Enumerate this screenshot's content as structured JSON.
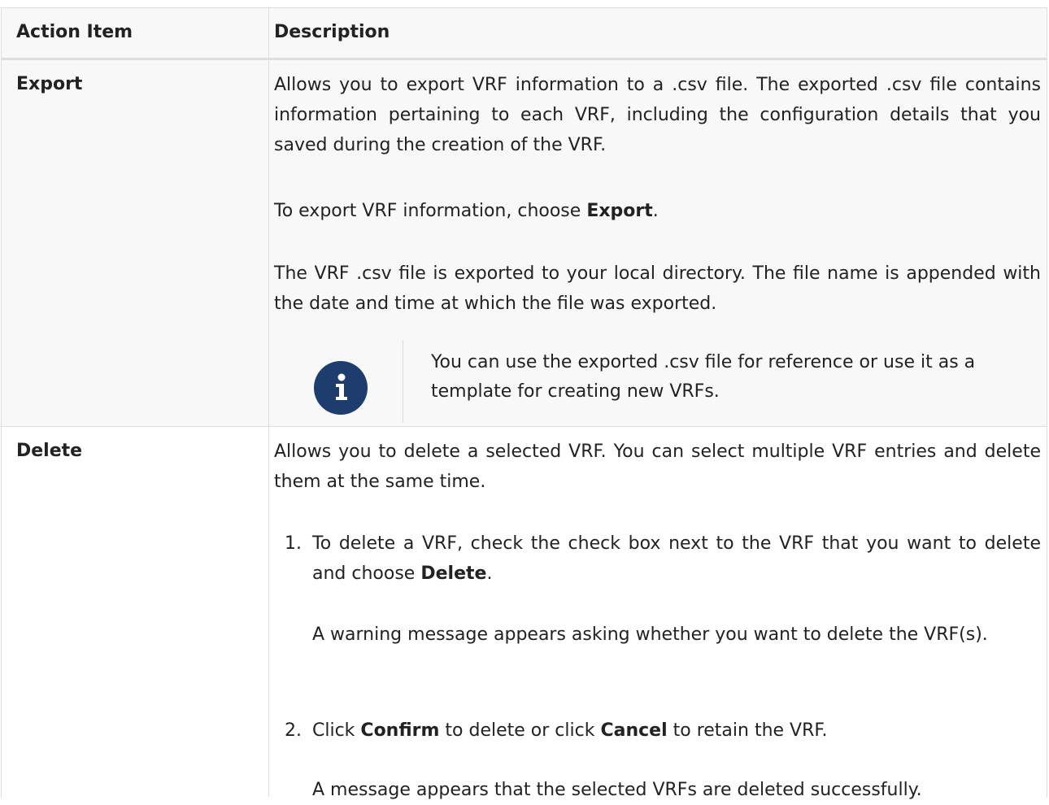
{
  "table": {
    "headers": [
      "Action Item",
      "Description"
    ],
    "rows": [
      {
        "action": "Export",
        "paragraphs": [
          "Allows you to export VRF information to a .csv file. The exported .csv file contains information pertaining to each VRF, including the configuration details that you saved during the creation of the VRF.",
          "To export VRF information, choose ",
          "The VRF .csv file is exported to your local directory. The file name is appended with the date and time at which the file was exported."
        ],
        "inline_bold": "Export",
        "inline_tail": ".",
        "note": {
          "icon": "info-icon",
          "text": "You can use the exported .csv file for reference or use it as a template for creating new VRFs."
        }
      },
      {
        "action": "Delete",
        "intro": "Allows you to delete a selected VRF. You can select multiple VRF entries and delete them at the same time.",
        "steps": [
          {
            "number": "1.",
            "text_a": "To delete a VRF, check the check box next to the VRF that you want to delete and choose ",
            "bold_a": "Delete",
            "text_b": ".",
            "followup": "A warning message appears asking whether you want to delete the VRF(s)."
          },
          {
            "number": "2.",
            "text_a": "Click ",
            "bold_a": "Confirm",
            "text_b": " to delete or click ",
            "bold_b": "Cancel",
            "text_c": " to retain the VRF.",
            "followup": "A message appears that the selected VRFs are deleted successfully."
          }
        ]
      }
    ]
  },
  "colors": {
    "header_bg": "#f7f8f7",
    "border": "#dedede",
    "info_icon_bg": "#1c3d6e"
  }
}
